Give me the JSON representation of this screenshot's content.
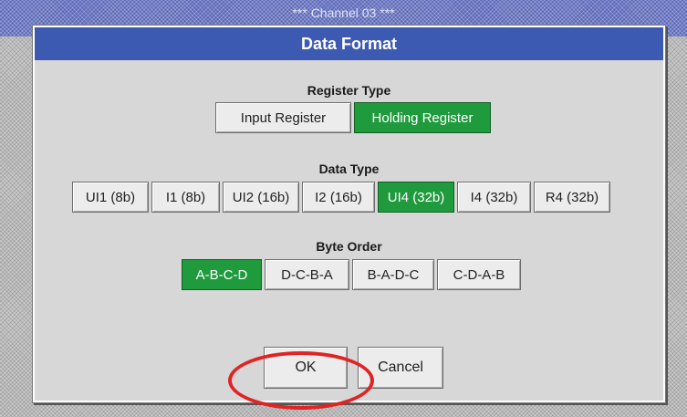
{
  "background": {
    "title": "*** Channel 03 ***"
  },
  "dialog": {
    "title": "Data Format",
    "register_type": {
      "label": "Register Type",
      "options": [
        "Input Register",
        "Holding Register"
      ],
      "selected": "Holding Register"
    },
    "data_type": {
      "label": "Data Type",
      "options": [
        "UI1 (8b)",
        "I1 (8b)",
        "UI2 (16b)",
        "I2 (16b)",
        "UI4 (32b)",
        "I4 (32b)",
        "R4 (32b)"
      ],
      "selected": "UI4 (32b)"
    },
    "byte_order": {
      "label": "Byte Order",
      "options": [
        "A-B-C-D",
        "D-C-B-A",
        "B-A-D-C",
        "C-D-A-B"
      ],
      "selected": "A-B-C-D"
    },
    "ok_label": "OK",
    "cancel_label": "Cancel"
  },
  "colors": {
    "selected": "#1f9a3c",
    "title_bar": "#3d5ab3",
    "highlight_circle": "#e02424"
  }
}
